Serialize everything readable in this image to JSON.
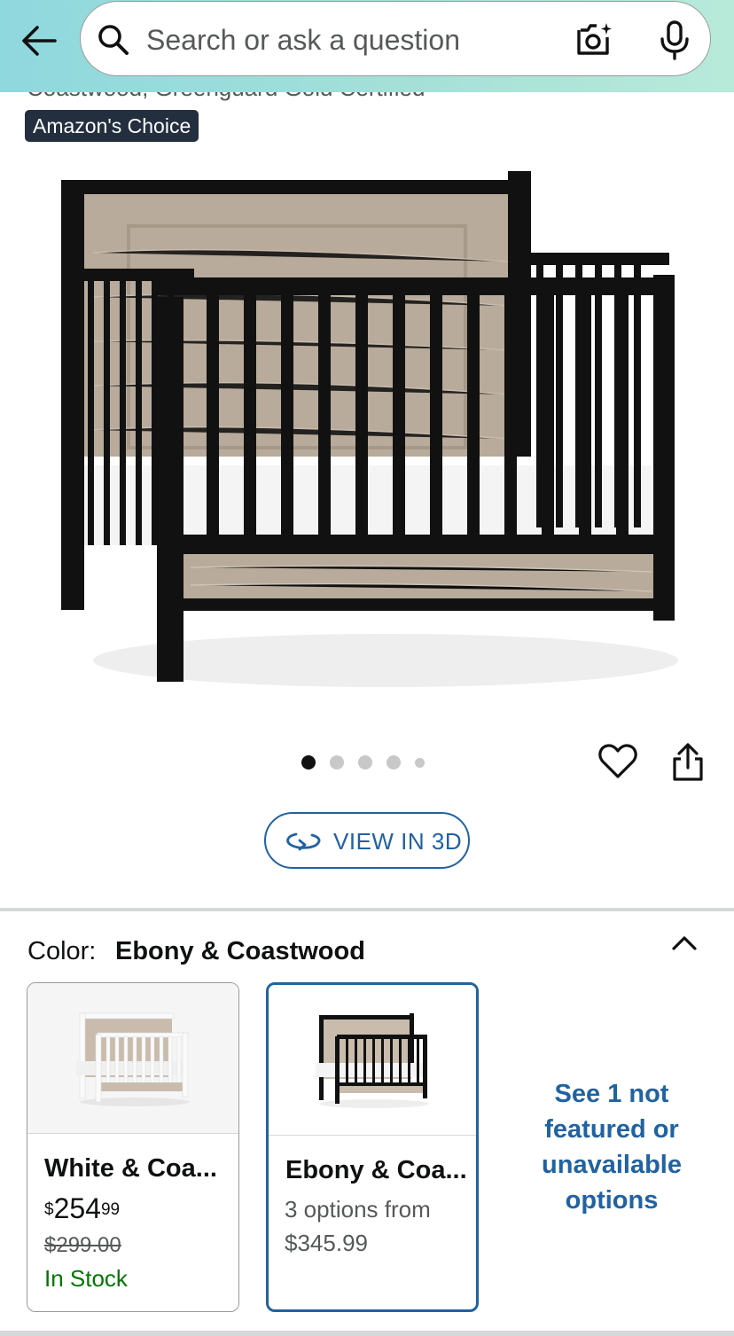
{
  "header": {
    "search_placeholder": "Search or ask a question",
    "background_colors": [
      "#8fd8de",
      "#b8ead9"
    ],
    "icons": [
      "back-arrow-icon",
      "search-icon",
      "camera-icon",
      "microphone-icon"
    ]
  },
  "product": {
    "title_fragment": "Coastwood, Greenguard Gold Certified",
    "badge": "Amazon's Choice",
    "image_count": 5,
    "image_active_index": 0,
    "view_3d_label": "VIEW IN 3D"
  },
  "variations": {
    "color_label": "Color:",
    "color_value": "Ebony & Coastwood",
    "options": [
      {
        "name": "White & Coa...",
        "price_symbol": "$",
        "price_whole": "254",
        "price_fraction": "99",
        "list_price": "$299.00",
        "availability": "In Stock",
        "selected": false
      },
      {
        "name": "Ebony & Coa...",
        "options_text": "3 options from",
        "options_price": "$345.99",
        "selected": true
      }
    ],
    "see_more": "See 1 not featured or unavailable options"
  },
  "colors": {
    "accent_blue": "#2162a1",
    "in_stock_green": "#007600",
    "badge_bg": "#232f3e"
  }
}
